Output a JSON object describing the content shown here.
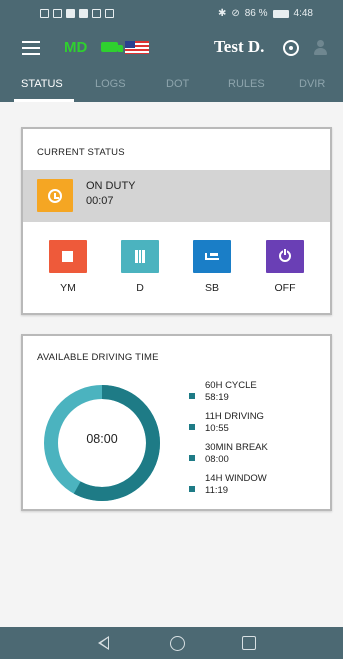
{
  "status_bar": {
    "battery_percent": "86 %",
    "time": "4:48"
  },
  "app_bar": {
    "badge": "MD",
    "username": "Test D."
  },
  "tabs": [
    {
      "label": "STATUS"
    },
    {
      "label": "LOGS"
    },
    {
      "label": "DOT"
    },
    {
      "label": "RULES"
    },
    {
      "label": "DVIR"
    }
  ],
  "current_status": {
    "title": "CURRENT STATUS",
    "status": "ON DUTY",
    "elapsed": "00:07",
    "color": "#f5a623"
  },
  "status_buttons": [
    {
      "label": "YM",
      "color": "#ee5a3a",
      "icon": "box-icon"
    },
    {
      "label": "D",
      "color": "#4bb3bf",
      "icon": "road-icon"
    },
    {
      "label": "SB",
      "color": "#1a7ec7",
      "icon": "bed-icon"
    },
    {
      "label": "OFF",
      "color": "#6a3fb5",
      "icon": "power-icon"
    }
  ],
  "driving_time": {
    "title": "AVAILABLE DRIVING TIME",
    "center_value": "08:00",
    "ring_fill_fraction": 0.58,
    "ring_colors": {
      "main": "#1e7b86",
      "accent": "#4bb3bf"
    },
    "legend": [
      {
        "name": "60H CYCLE",
        "value": "58:19"
      },
      {
        "name": "11H DRIVING",
        "value": "10:55"
      },
      {
        "name": "30MIN BREAK",
        "value": "08:00"
      },
      {
        "name": "14H WINDOW",
        "value": "11:19"
      }
    ]
  }
}
